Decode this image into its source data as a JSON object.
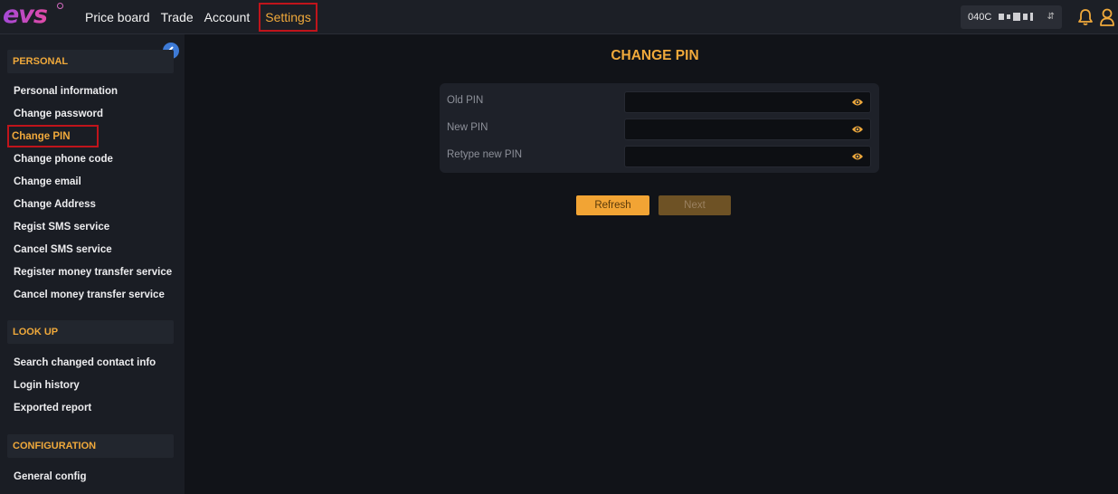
{
  "topbar": {
    "logo_text": "evs",
    "nav": [
      {
        "label": "Price board"
      },
      {
        "label": "Trade"
      },
      {
        "label": "Account"
      },
      {
        "label": "Settings",
        "active": true
      }
    ],
    "account_prefix": "040C"
  },
  "sidebar": {
    "sections": [
      {
        "title": "PERSONAL",
        "items": [
          {
            "label": "Personal information"
          },
          {
            "label": "Change password"
          },
          {
            "label": "Change PIN",
            "active": true
          },
          {
            "label": "Change phone code"
          },
          {
            "label": "Change email"
          },
          {
            "label": "Change Address"
          },
          {
            "label": "Regist SMS service"
          },
          {
            "label": "Cancel SMS service"
          },
          {
            "label": "Register money transfer service"
          },
          {
            "label": "Cancel money transfer service"
          }
        ]
      },
      {
        "title": "LOOK UP",
        "items": [
          {
            "label": "Search changed contact info"
          },
          {
            "label": "Login history"
          },
          {
            "label": "Exported report"
          }
        ]
      },
      {
        "title": "CONFIGURATION",
        "items": [
          {
            "label": "General config"
          }
        ]
      }
    ]
  },
  "main": {
    "title": "CHANGE PIN",
    "fields": [
      {
        "label": "Old PIN",
        "value": ""
      },
      {
        "label": "New PIN",
        "value": ""
      },
      {
        "label": "Retype new PIN",
        "value": ""
      }
    ],
    "buttons": {
      "refresh": "Refresh",
      "next": "Next"
    }
  },
  "colors": {
    "accent": "#f0a93b",
    "highlight_box": "#c0141b",
    "collapse_button": "#3d7ad6"
  },
  "icons": [
    "chevron-left-icon",
    "eye-icon",
    "bell-icon",
    "user-icon",
    "caret-icon"
  ]
}
